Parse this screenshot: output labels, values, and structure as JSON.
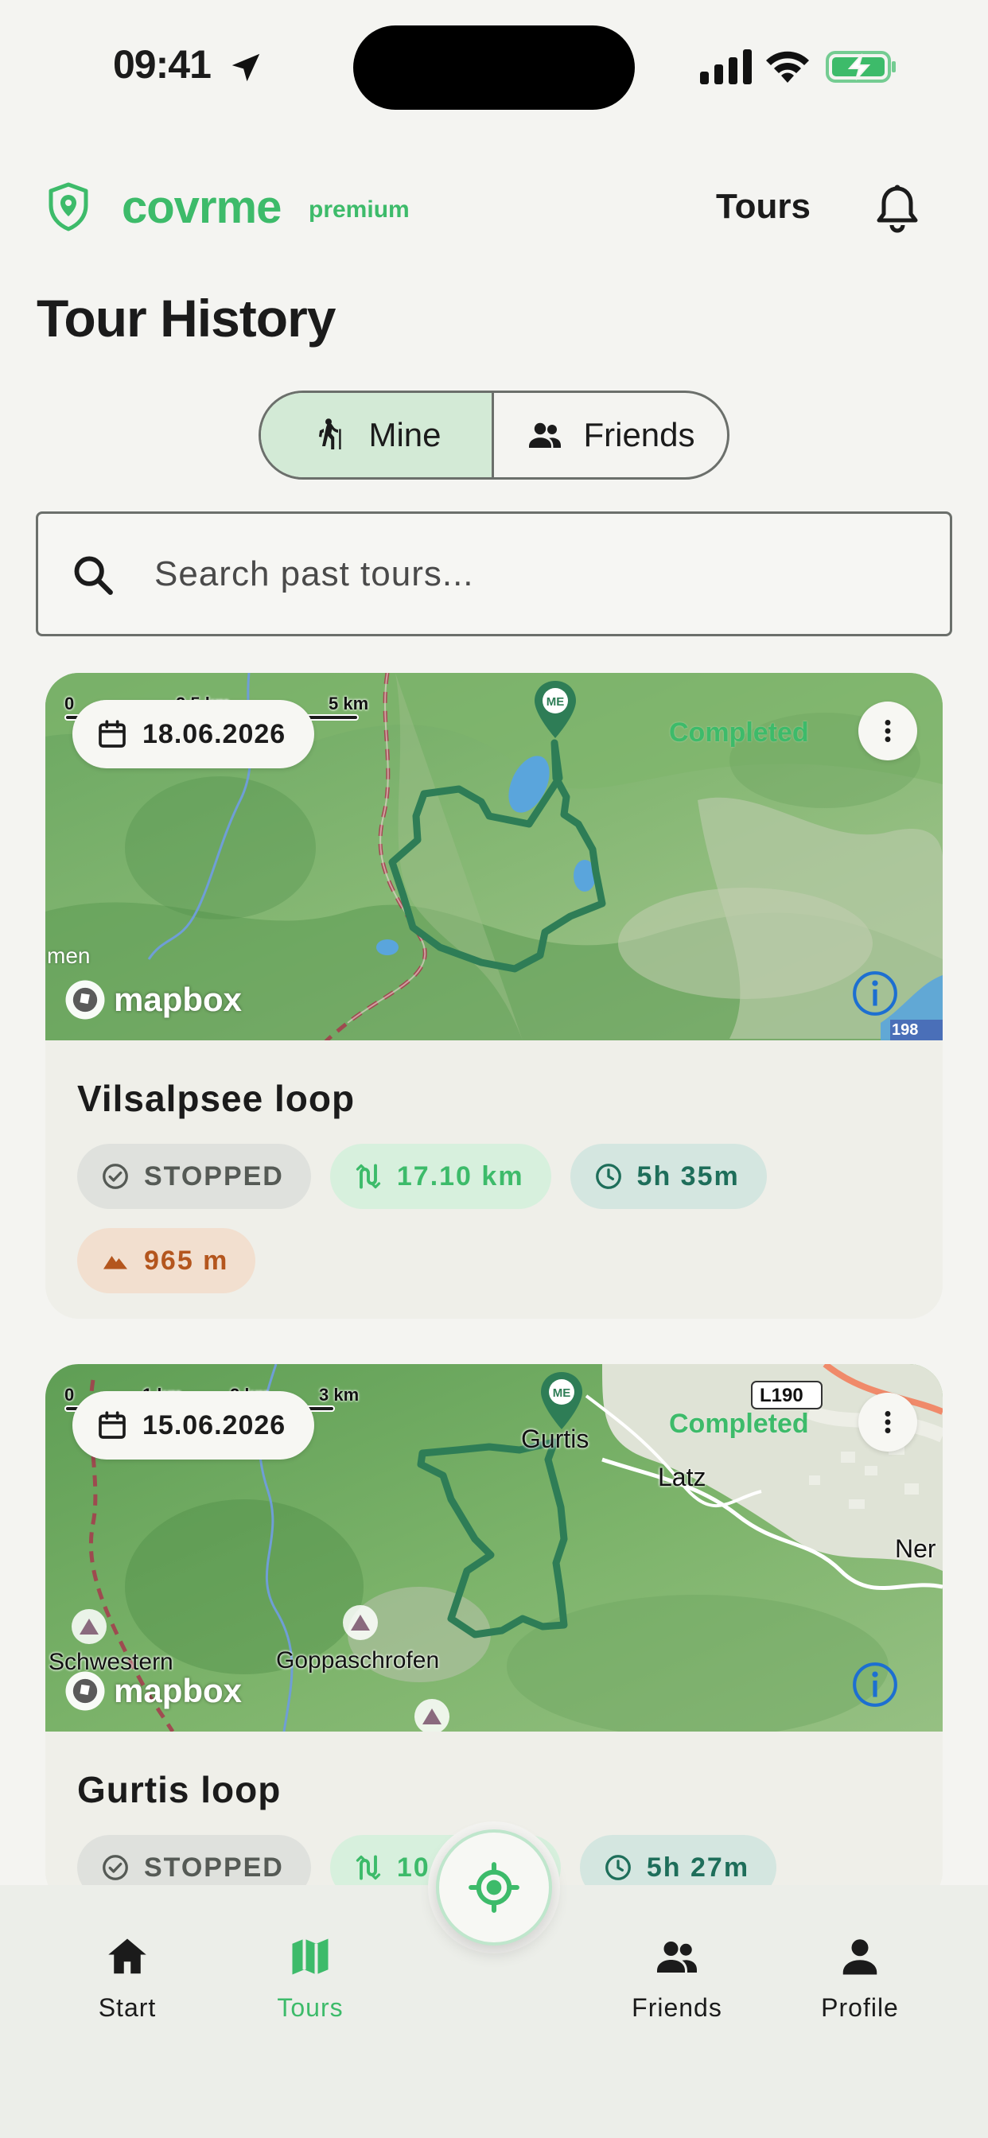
{
  "status_bar": {
    "time": "09:41"
  },
  "header": {
    "brand_name": "covrme",
    "brand_badge": "premium",
    "nav_title": "Tours"
  },
  "page_title": "Tour History",
  "segmented": {
    "mine_label": "Mine",
    "friends_label": "Friends",
    "selected": "Mine"
  },
  "search": {
    "placeholder": "Search past tours..."
  },
  "tours": [
    {
      "date": "18.06.2026",
      "status_label": "Completed",
      "scale": [
        "0",
        "2.5 km",
        "5 km"
      ],
      "map_labels": [
        "men",
        "198"
      ],
      "pin_label": "ME",
      "mapbox": "mapbox",
      "title": "Vilsalpsee loop",
      "state": "STOPPED",
      "distance": "17.10 km",
      "duration": "5h 35m",
      "elevation": "965 m"
    },
    {
      "date": "15.06.2026",
      "status_label": "Completed",
      "scale": [
        "0",
        "1 km",
        "2 km",
        "3 km"
      ],
      "map_labels": [
        "Gurtis",
        "Latz",
        "Ner",
        "Schwestern",
        "Goppaschrofen",
        "L190"
      ],
      "pin_label": "ME",
      "mapbox": "mapbox",
      "title": "Gurtis loop",
      "state": "STOPPED",
      "distance": "10.5",
      "duration": "5h 27m"
    }
  ],
  "bottom_nav": {
    "start": "Start",
    "tours": "Tours",
    "friends": "Friends",
    "profile": "Profile",
    "active": "Tours"
  },
  "colors": {
    "brand_green": "#3dbb6a",
    "route_green": "#2e7d56",
    "background": "#f4f4f1"
  }
}
